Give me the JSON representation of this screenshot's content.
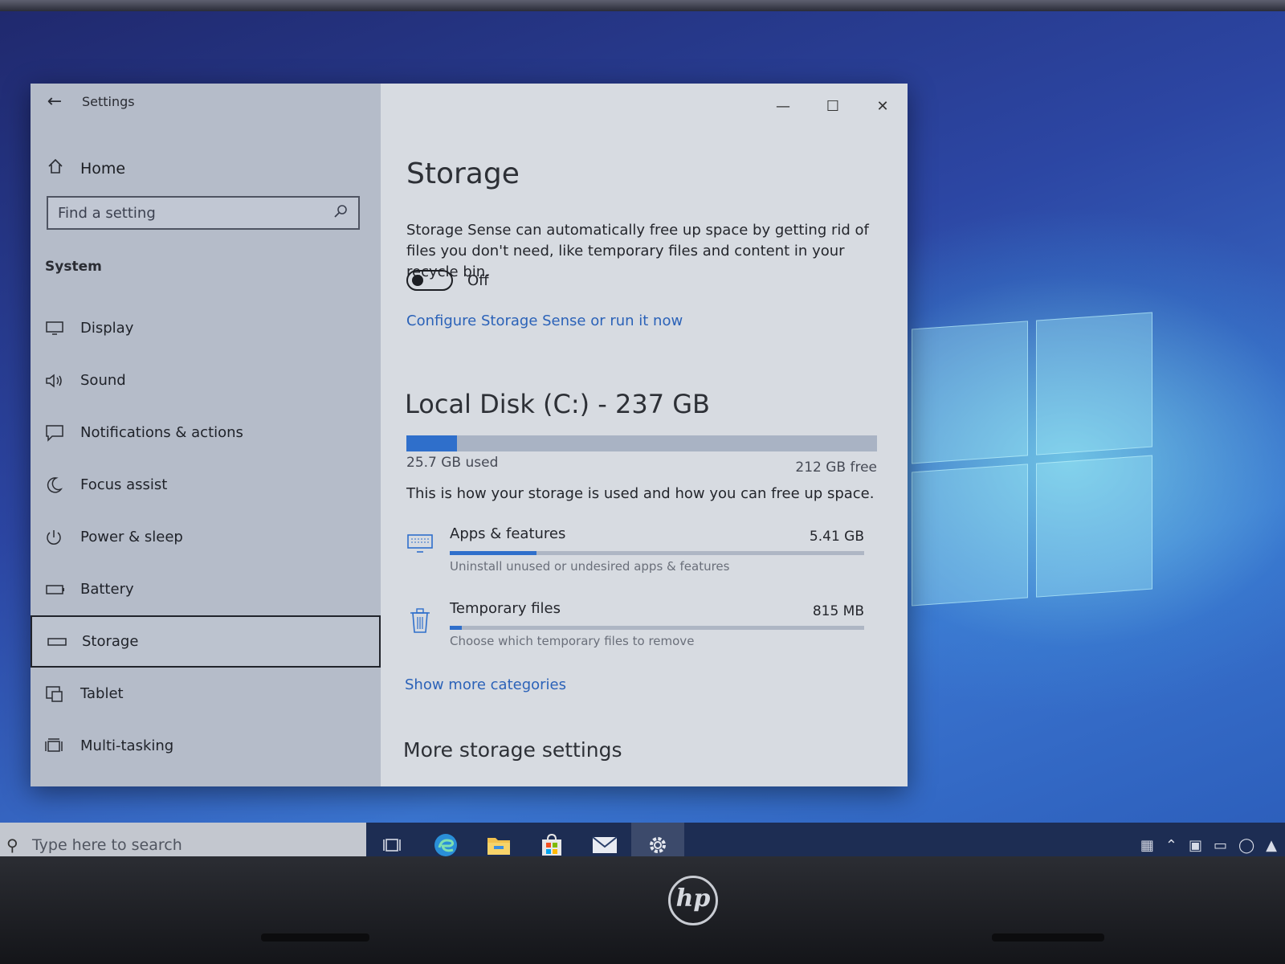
{
  "settings": {
    "app_title": "Settings",
    "home_label": "Home",
    "search_placeholder": "Find a setting",
    "section_label": "System",
    "nav": [
      {
        "label": "Display",
        "icon": "display-icon"
      },
      {
        "label": "Sound",
        "icon": "speaker-icon"
      },
      {
        "label": "Notifications & actions",
        "icon": "notification-icon"
      },
      {
        "label": "Focus assist",
        "icon": "moon-icon"
      },
      {
        "label": "Power & sleep",
        "icon": "power-icon"
      },
      {
        "label": "Battery",
        "icon": "battery-icon"
      },
      {
        "label": "Storage",
        "icon": "storage-icon",
        "selected": true
      },
      {
        "label": "Tablet",
        "icon": "tablet-icon"
      },
      {
        "label": "Multi-tasking",
        "icon": "multitasking-icon"
      }
    ]
  },
  "storage": {
    "title": "Storage",
    "description": "Storage Sense can automatically free up space by getting rid of files you don't need, like temporary files and content in your recycle bin.",
    "toggle_state": "Off",
    "configure_link": "Configure Storage Sense or run it now",
    "disk_title": "Local Disk (C:) - 237 GB",
    "disk_used_fraction": 0.108,
    "used_label": "25.7 GB used",
    "free_label": "212 GB free",
    "usage_text": "This is how your storage is used and how you can free up space.",
    "categories": [
      {
        "name": "Apps & features",
        "size": "5.41 GB",
        "sub": "Uninstall unused or undesired apps & features",
        "fill_fraction": 0.21,
        "icon": "monitor-icon"
      },
      {
        "name": "Temporary files",
        "size": "815 MB",
        "sub": "Choose which temporary files to remove",
        "fill_fraction": 0.03,
        "icon": "trash-icon"
      }
    ],
    "show_more": "Show more categories",
    "more_settings": "More storage settings"
  },
  "taskbar": {
    "search_placeholder": "Type here to search",
    "icons": [
      "task-view-icon",
      "edge-icon",
      "file-explorer-icon",
      "store-icon",
      "mail-icon",
      "settings-gear-icon"
    ]
  },
  "colors": {
    "accent": "#2f6fcb",
    "link": "#2b62b8",
    "sidebar_bg": "#b5bcc9",
    "content_bg": "#d7dbe1",
    "taskbar_bg": "#1d2d53"
  }
}
